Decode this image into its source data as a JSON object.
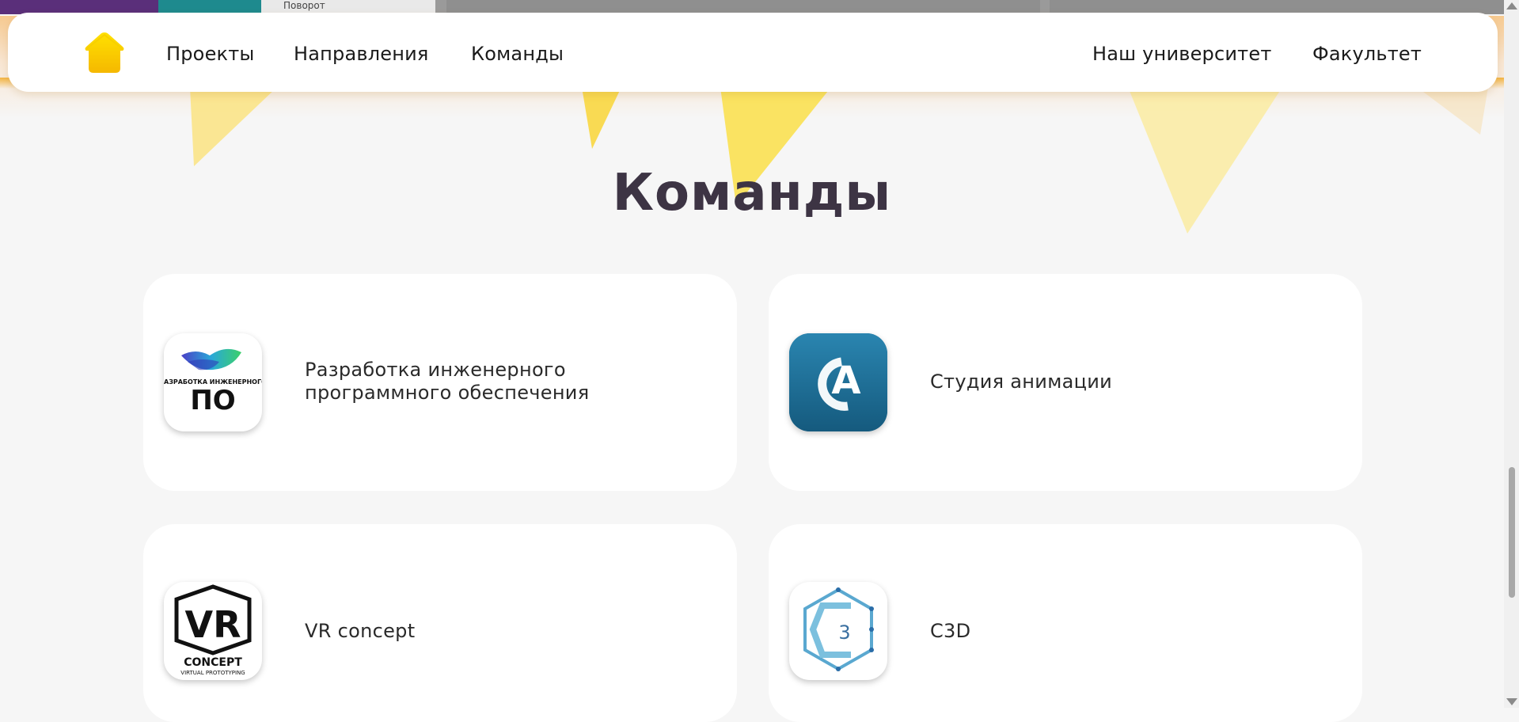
{
  "top_strip": {
    "text": "Поворот"
  },
  "header": {
    "home_icon": "home-icon",
    "nav_left": [
      "Проекты",
      "Направления",
      "Команды"
    ],
    "nav_right": [
      "Наш университет",
      "Факультет"
    ]
  },
  "page": {
    "title": "Команды"
  },
  "teams": [
    {
      "name": "Разработка инженерного программного обеспечения",
      "name_line1": "Разработка инженерного",
      "name_line2": "программного обеспечения",
      "logo_text_top": "РАЗРАБОТКА ИНЖЕНЕРНОГО",
      "logo_text_big": "ПО"
    },
    {
      "name": "Студия анимации",
      "logo_text": "A"
    },
    {
      "name": "VR concept",
      "logo_text_big": "VR",
      "logo_text_sub1": "CONCEPT",
      "logo_text_sub2": "VIRTUAL PROTOTYPING"
    },
    {
      "name": "C3D",
      "logo_text": "3"
    }
  ],
  "colors": {
    "accent_yellow": "#ffd000",
    "title": "#3d3444",
    "background": "#f6f6f6",
    "animation_logo": "#1e6c94"
  }
}
